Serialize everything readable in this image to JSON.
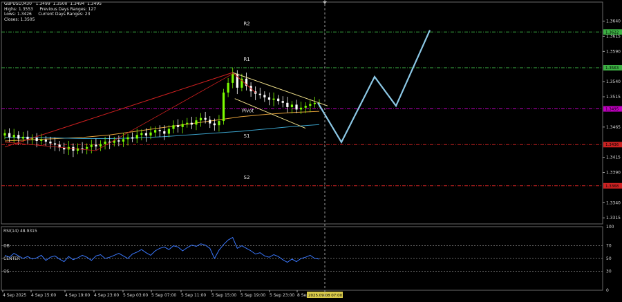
{
  "header": {
    "line1": "GBPUSD,M30   1.3499  1.3500  1.3494  1.3495",
    "line2": "Highs: 1.3553     Previous Days Ranges: 127",
    "line3": "Lows: 1.3426     Current Days Ranges: 23",
    "line4": "Closes: 1.3505"
  },
  "colors": {
    "background": "#000000",
    "bull_candle": "#7CFC00",
    "bear_candle": "#ffffff",
    "r_lines": "#3cb043",
    "pivot_line": "#c000c0",
    "s_lines": "#cc2222",
    "forecast": "#8cc8e6",
    "rsi_line": "#3a78ff"
  },
  "chart_data": [
    {
      "type": "line",
      "title": "",
      "y_range": [
        1.3305,
        1.3668
      ],
      "price_ticks": [
        "1.3640",
        "1.3615",
        "1.3590",
        "1.3540",
        "1.3515",
        "1.3465",
        "1.3415",
        "1.3390",
        "1.3340",
        "1.3315"
      ],
      "time_ticks": [
        "4 Sep 2025",
        "4 Sep 15:00",
        "4 Sep 19:00",
        "4 Sep 23:00",
        "5 Sep 03:00",
        "5 Sep 07:00",
        "5 Sep 11:00",
        "5 Sep 15:00",
        "5 Sep 19:00",
        "5 Sep 23:00",
        "8 Sep"
      ],
      "crosshair_time": "2025.09.08 07:00",
      "levels": [
        {
          "name": "R2",
          "price": 1.3622,
          "label": "1.3622"
        },
        {
          "name": "R1",
          "price": 1.3563,
          "label": "1.3563"
        },
        {
          "name": "Pivot",
          "price": 1.3495,
          "label": "1.3495"
        },
        {
          "name": "S1",
          "price": 1.3436,
          "label": "1.3436"
        },
        {
          "name": "S2",
          "price": 1.3368,
          "label": "1.3368"
        }
      ],
      "close_series": [
        1.3455,
        1.3448,
        1.3452,
        1.3446,
        1.3449,
        1.3445,
        1.3447,
        1.3442,
        1.3444,
        1.3441,
        1.3438,
        1.3436,
        1.3431,
        1.3428,
        1.3432,
        1.3426,
        1.343,
        1.3429,
        1.3432,
        1.3436,
        1.3433,
        1.3437,
        1.3441,
        1.3439,
        1.3443,
        1.3441,
        1.3445,
        1.3448,
        1.3446,
        1.3452,
        1.3455,
        1.3451,
        1.3456,
        1.346,
        1.3458,
        1.3454,
        1.3462,
        1.3468,
        1.3465,
        1.347,
        1.3472,
        1.3469,
        1.3476,
        1.348,
        1.3477,
        1.3471,
        1.3468,
        1.3475,
        1.3522,
        1.3538,
        1.3553,
        1.353,
        1.3545,
        1.3533,
        1.3524,
        1.352,
        1.3518,
        1.3514,
        1.351,
        1.3512,
        1.3508,
        1.3505,
        1.3498,
        1.3502,
        1.3494,
        1.3497,
        1.35,
        1.3503,
        1.3505,
        1.3505
      ],
      "moving_averages": [
        {
          "values": [
            1.3442,
            1.3444,
            1.3446,
            1.3448,
            1.3452,
            1.3458,
            1.3464,
            1.347,
            1.3476,
            1.3482,
            1.3486,
            1.3489,
            1.3491
          ],
          "color": "#e8a33a"
        },
        {
          "values": [
            1.3448,
            1.3448,
            1.3447,
            1.3446,
            1.3446,
            1.3447,
            1.3449,
            1.3452,
            1.3455,
            1.3458,
            1.3462,
            1.3466,
            1.3469
          ],
          "color": "#3aa0c8"
        }
      ],
      "forecast_path": [
        1.3505,
        1.344,
        1.3548,
        1.35,
        1.3625
      ]
    },
    {
      "type": "line",
      "title": "RSI(14) 48.9315",
      "y_range": [
        0,
        100
      ],
      "ticks": [
        "100",
        "70",
        "50",
        "30",
        "0"
      ],
      "levels": [
        {
          "name": "OB",
          "value": 70
        },
        {
          "name": "CENTER",
          "value": 50
        },
        {
          "name": "OS",
          "value": 30
        }
      ],
      "values": [
        55,
        52,
        58,
        54,
        50,
        53,
        49,
        51,
        55,
        47,
        52,
        54,
        49,
        45,
        53,
        48,
        51,
        55,
        52,
        47,
        54,
        56,
        50,
        52,
        55,
        58,
        54,
        50,
        57,
        60,
        64,
        59,
        55,
        62,
        66,
        68,
        64,
        70,
        68,
        62,
        67,
        71,
        69,
        73,
        71,
        66,
        50,
        63,
        72,
        79,
        83,
        66,
        70,
        66,
        62,
        57,
        59,
        54,
        52,
        56,
        53,
        48,
        44,
        49,
        45,
        50,
        52,
        55,
        50,
        49
      ]
    }
  ]
}
